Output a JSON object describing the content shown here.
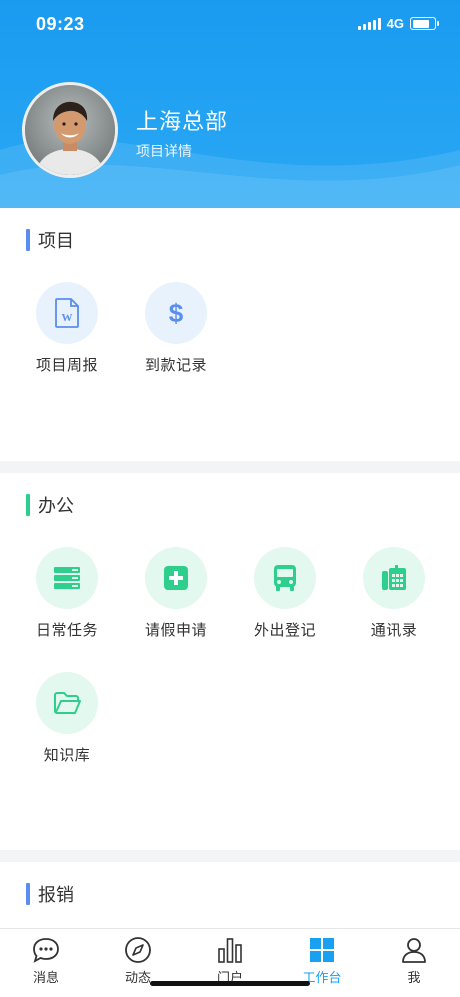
{
  "status": {
    "time": "09:23",
    "network": "4G",
    "battery_level": 0.8
  },
  "header": {
    "org_name": "上海总部",
    "subtitle": "项目详情"
  },
  "sections": {
    "project": {
      "title": "项目",
      "accent": "#5b8def",
      "items": [
        {
          "label": "项目周报",
          "icon": "word-doc-icon"
        },
        {
          "label": "到款记录",
          "icon": "dollar-icon"
        }
      ]
    },
    "office": {
      "title": "办公",
      "accent": "#2ecf8c",
      "items": [
        {
          "label": "日常任务",
          "icon": "task-list-icon"
        },
        {
          "label": "请假申请",
          "icon": "plus-square-icon"
        },
        {
          "label": "外出登记",
          "icon": "bus-icon"
        },
        {
          "label": "通讯录",
          "icon": "phone-book-icon"
        },
        {
          "label": "知识库",
          "icon": "folder-icon"
        }
      ]
    },
    "reimburse": {
      "title": "报销",
      "accent": "#5b8def"
    }
  },
  "tabbar": {
    "active": "工作台",
    "items": [
      {
        "label": "消息",
        "icon": "chat-bubble-icon"
      },
      {
        "label": "动态",
        "icon": "compass-icon"
      },
      {
        "label": "门户",
        "icon": "bar-chart-icon"
      },
      {
        "label": "工作台",
        "icon": "grid-icon"
      },
      {
        "label": "我",
        "icon": "user-icon"
      }
    ]
  },
  "colors": {
    "header_blue": "#1a9bf0",
    "active_tab": "#1aa0f0",
    "office_green": "#2ecf8c",
    "project_blue": "#5b8def"
  }
}
